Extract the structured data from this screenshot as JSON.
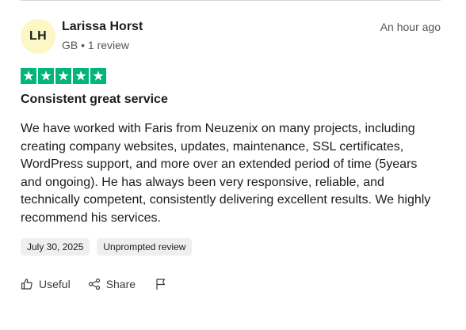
{
  "reviewer": {
    "initials": "LH",
    "name": "Larissa Horst",
    "meta": "GB • 1 review"
  },
  "review": {
    "timestamp": "An hour ago",
    "rating": 5,
    "title": "Consistent great service",
    "body": "We have worked with Faris from Neuzenix on many projects, including creating company websites, updates, maintenance, SSL certificates, WordPress support, and more over an extended period of time (5years and ongoing). He has always been very responsive, reliable, and technically competent, consistently delivering excellent results. We highly recommend his services.",
    "tags": [
      "July 30, 2025",
      "Unprompted review"
    ]
  },
  "actions": {
    "useful_label": "Useful",
    "share_label": "Share"
  },
  "colors": {
    "star_green": "#00b67a",
    "avatar_bg": "#fcf7c5",
    "tag_bg": "#efefef"
  },
  "icons": [
    "thumbs-up-icon",
    "share-icon",
    "flag-icon",
    "star-icon"
  ]
}
